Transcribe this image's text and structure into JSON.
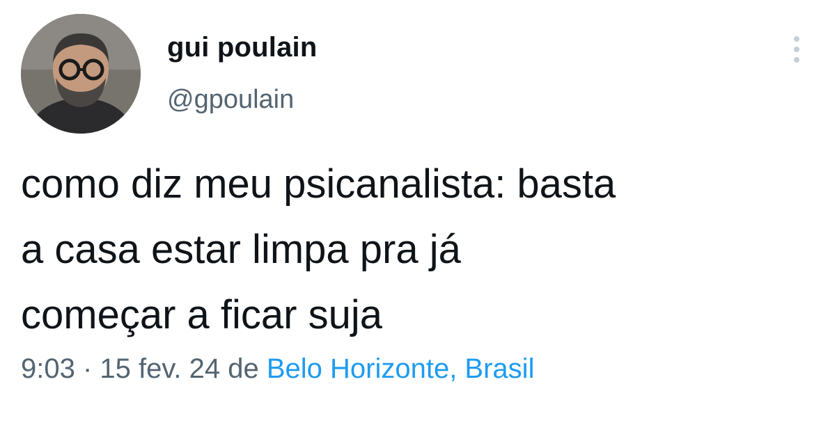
{
  "user": {
    "display_name": "gui poulain",
    "handle": "@gpoulain"
  },
  "tweet": {
    "lines": [
      "como diz meu psicanalista: basta",
      "a casa estar limpa pra já",
      "começar a ficar suja"
    ]
  },
  "meta": {
    "time": "9:03",
    "separator": " · ",
    "date": "15 fev. 24",
    "from": " de ",
    "location": "Belo Horizonte, Brasil"
  },
  "colors": {
    "text": "#0f1419",
    "secondary": "#536471",
    "link": "#1d9bf0"
  },
  "icons": {
    "more": "more-vertical-icon"
  }
}
